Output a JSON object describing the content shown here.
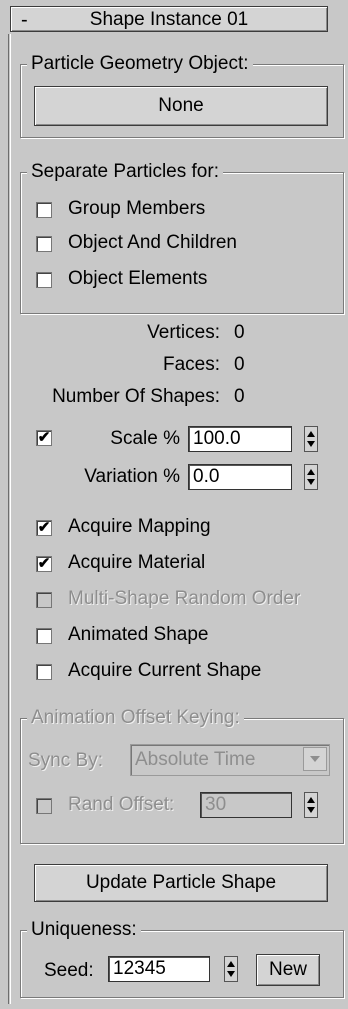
{
  "rollout": {
    "collapse_symbol": "-",
    "title": "Shape Instance 01"
  },
  "geometry": {
    "legend": "Particle Geometry Object:",
    "object_button": "None"
  },
  "separate": {
    "legend": "Separate Particles for:",
    "options": [
      {
        "label": "Group Members",
        "checked": false
      },
      {
        "label": "Object And Children",
        "checked": false
      },
      {
        "label": "Object Elements",
        "checked": false
      }
    ]
  },
  "stats": {
    "vertices_label": "Vertices:",
    "vertices_value": "0",
    "faces_label": "Faces:",
    "faces_value": "0",
    "shapes_label": "Number Of Shapes:",
    "shapes_value": "0"
  },
  "scale": {
    "checked": true,
    "check_glyph": "✔",
    "scale_label": "Scale %",
    "scale_value": "100.0",
    "variation_label": "Variation %",
    "variation_value": "0.0"
  },
  "options": [
    {
      "label": "Acquire Mapping",
      "checked": true,
      "enabled": true
    },
    {
      "label": "Acquire Material",
      "checked": true,
      "enabled": true
    },
    {
      "label": "Multi-Shape Random Order",
      "checked": false,
      "enabled": false
    },
    {
      "label": "Animated Shape",
      "checked": false,
      "enabled": true
    },
    {
      "label": "Acquire Current Shape",
      "checked": false,
      "enabled": true
    }
  ],
  "offset_keying": {
    "legend": "Animation Offset Keying:",
    "sync_label": "Sync By:",
    "sync_value": "Absolute Time",
    "rand_label": "Rand Offset:",
    "rand_value": "30",
    "enabled": false
  },
  "update_button": "Update Particle Shape",
  "uniqueness": {
    "legend": "Uniqueness:",
    "seed_label": "Seed:",
    "seed_value": "12345",
    "new_button": "New"
  },
  "icons": {
    "spinner": "spinner-arrows-icon",
    "dropdown": "dropdown-arrow-icon",
    "checkmark": "checkmark-icon"
  },
  "colors": {
    "panel_bg": "#c8c8c8",
    "disabled_text": "#8e8e8e"
  }
}
